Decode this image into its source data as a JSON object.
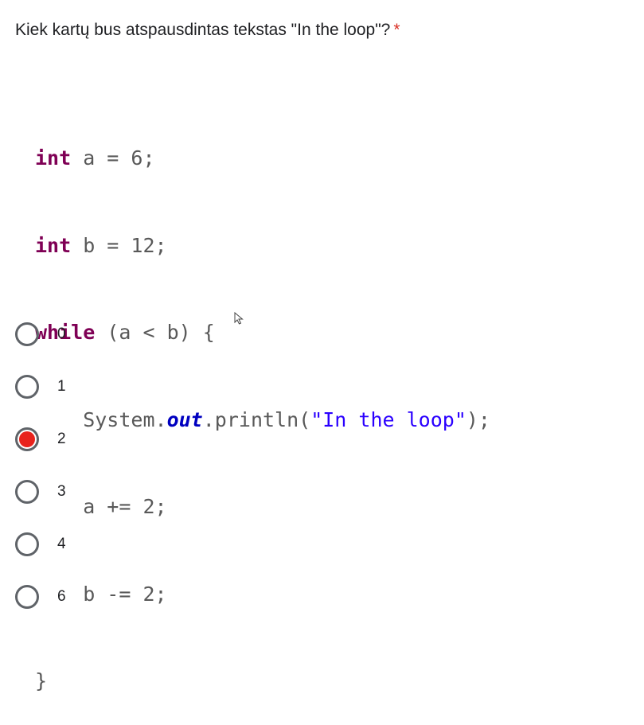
{
  "question": {
    "text": "Kiek kartų bus atspausdintas tekstas \"In the loop\"?",
    "required_mark": "*"
  },
  "code": {
    "kw_int": "int",
    "kw_while": "while",
    "line1_rest": " a = 6;",
    "line2_rest": " b = 12;",
    "line3_rest": " (a < b) {",
    "line4_pre": "    System.",
    "line4_field": "out",
    "line4_mid": ".println(",
    "line4_str": "\"In the loop\"",
    "line4_end": ");",
    "line5": "    a += 2;",
    "line6": "    b -= 2;",
    "line7": "}"
  },
  "options": [
    {
      "label": "0",
      "selected": false
    },
    {
      "label": "1",
      "selected": false
    },
    {
      "label": "2",
      "selected": true
    },
    {
      "label": "3",
      "selected": false
    },
    {
      "label": "4",
      "selected": false
    },
    {
      "label": "6",
      "selected": false
    }
  ],
  "colors": {
    "selected_fill": "#e8221c",
    "required": "#d93025",
    "keyword": "#7f0055",
    "string": "#2a00ff",
    "field": "#0000c0"
  }
}
